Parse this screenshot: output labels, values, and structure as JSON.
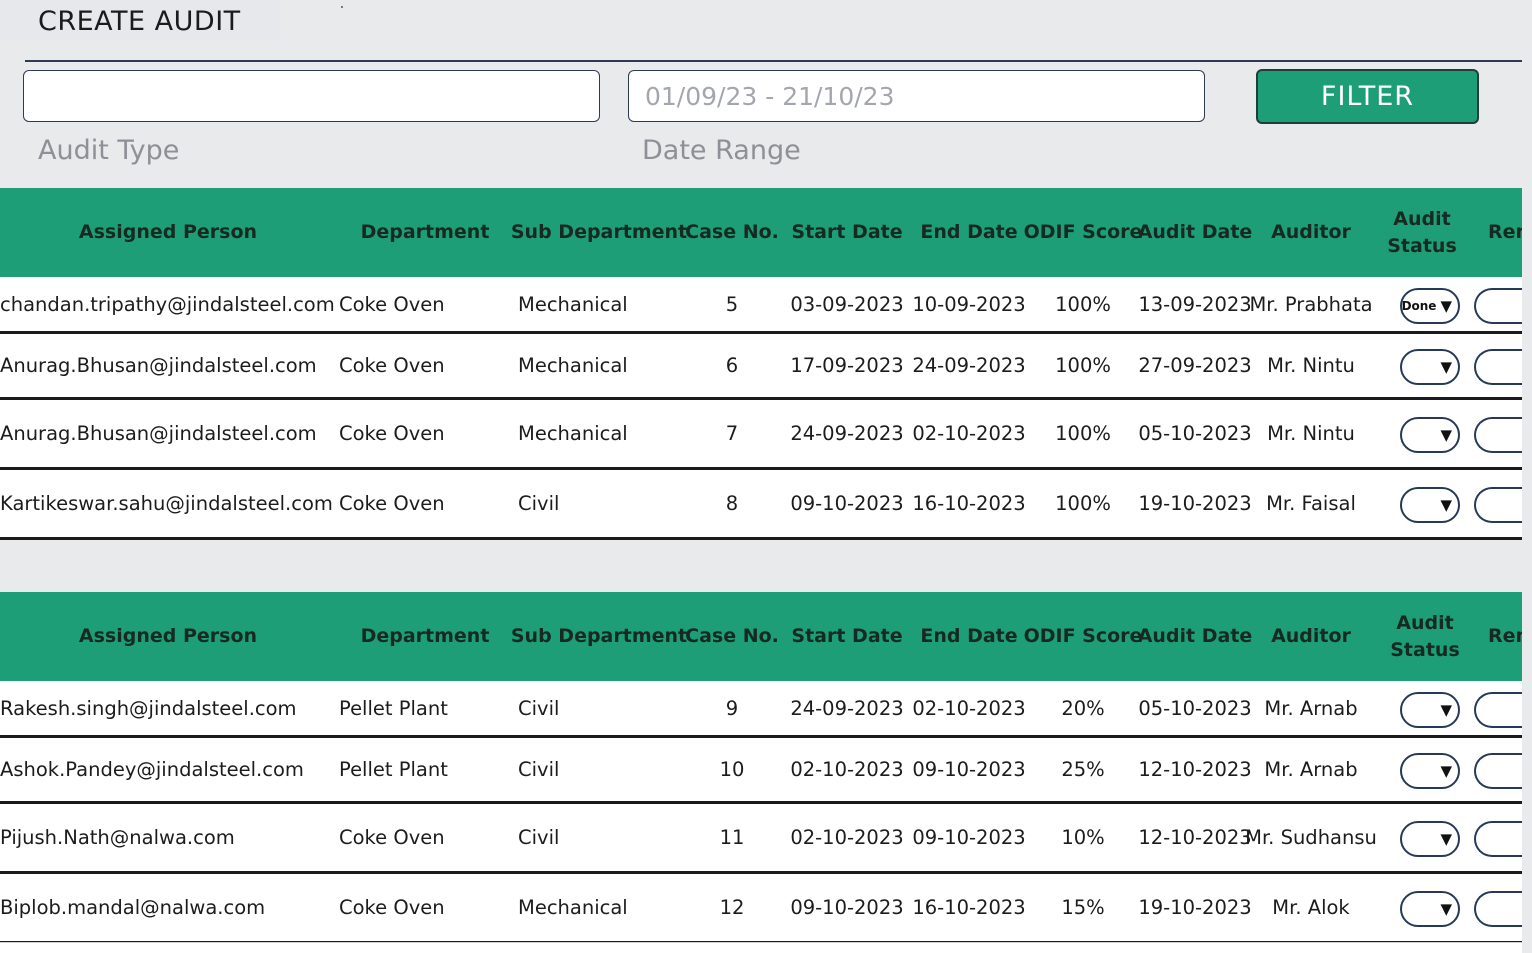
{
  "header": {
    "title": "CREATE AUDIT"
  },
  "filters": {
    "audit_type_value": "",
    "audit_type_label": "Audit Type",
    "date_range_placeholder": "01/09/23 - 21/10/23",
    "date_range_label": "Date Range",
    "filter_button": "FILTER"
  },
  "columns": [
    "Assigned Person",
    "Department",
    "Sub Department",
    "Case No.",
    "Start Date",
    "End Date",
    "ODIF Score",
    "Audit Date",
    "Auditor",
    "Audit Status",
    "Rem"
  ],
  "columns_audit_status": [
    "Audit",
    "Status"
  ],
  "table1": {
    "rows": [
      {
        "person": "chandan.tripathy@jindalsteel.com",
        "dept": "Coke Oven",
        "sub": "Mechanical",
        "case": "5",
        "start": "03-09-2023",
        "end": "10-09-2023",
        "score": "100%",
        "audit_date": "13-09-2023",
        "auditor": "Mr. Prabhata",
        "status": "Done"
      },
      {
        "person": "Anurag.Bhusan@jindalsteel.com",
        "dept": "Coke Oven",
        "sub": "Mechanical",
        "case": "6",
        "start": "17-09-2023",
        "end": "24-09-2023",
        "score": "100%",
        "audit_date": "27-09-2023",
        "auditor": "Mr. Nintu",
        "status": ""
      },
      {
        "person": "Anurag.Bhusan@jindalsteel.com",
        "dept": "Coke Oven",
        "sub": "Mechanical",
        "case": "7",
        "start": "24-09-2023",
        "end": "02-10-2023",
        "score": "100%",
        "audit_date": "05-10-2023",
        "auditor": "Mr. Nintu",
        "status": ""
      },
      {
        "person": "Kartikeswar.sahu@jindalsteel.com",
        "dept": "Coke Oven",
        "sub": "Civil",
        "case": "8",
        "start": "09-10-2023",
        "end": "16-10-2023",
        "score": "100%",
        "audit_date": "19-10-2023",
        "auditor": "Mr. Faisal",
        "status": ""
      }
    ]
  },
  "table2": {
    "rows": [
      {
        "person": "Rakesh.singh@jindalsteel.com",
        "dept": "Pellet Plant",
        "sub": "Civil",
        "case": "9",
        "start": "24-09-2023",
        "end": "02-10-2023",
        "score": "20%",
        "audit_date": "05-10-2023",
        "auditor": "Mr. Arnab",
        "status": ""
      },
      {
        "person": "Ashok.Pandey@jindalsteel.com",
        "dept": "Pellet Plant",
        "sub": "Civil",
        "case": "10",
        "start": "02-10-2023",
        "end": "09-10-2023",
        "score": "25%",
        "audit_date": "12-10-2023",
        "auditor": "Mr. Arnab",
        "status": ""
      },
      {
        "person": "Pijush.Nath@nalwa.com",
        "dept": "Coke Oven",
        "sub": "Civil",
        "case": "11",
        "start": "02-10-2023",
        "end": "09-10-2023",
        "score": "10%",
        "audit_date": "12-10-2023",
        "auditor": "Mr. Sudhansu",
        "status": ""
      },
      {
        "person": "Biplob.mandal@nalwa.com",
        "dept": "Coke Oven",
        "sub": "Mechanical",
        "case": "12",
        "start": "09-10-2023",
        "end": "16-10-2023",
        "score": "15%",
        "audit_date": "19-10-2023",
        "auditor": "Mr. Alok",
        "status": ""
      }
    ]
  },
  "colors": {
    "accent": "#1e9e77",
    "border": "#263a57",
    "background": "#e9eaec"
  }
}
